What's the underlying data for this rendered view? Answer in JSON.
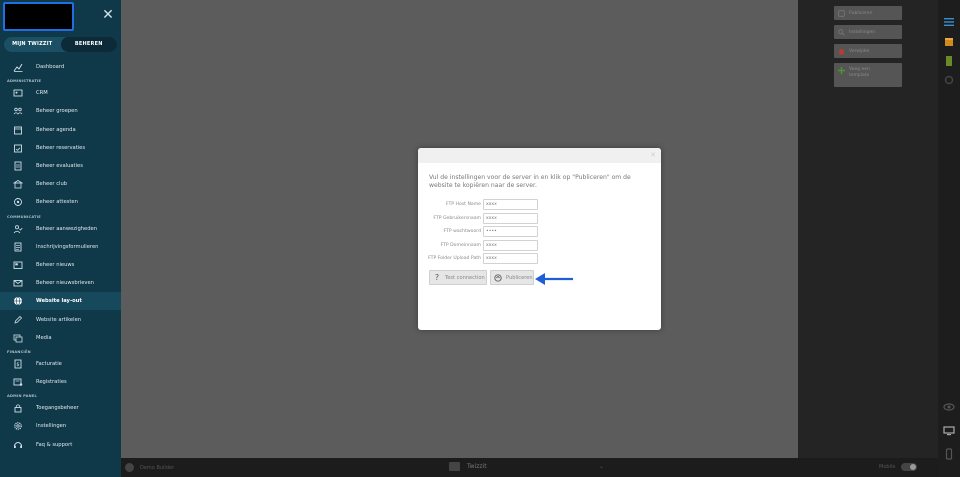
{
  "sidebar": {
    "tabs": [
      {
        "label": "MIJN TWIZZIT"
      },
      {
        "label": "BEHEREN"
      }
    ],
    "groups": [
      {
        "section": "",
        "items": [
          {
            "label": "Dashboard",
            "icon": "chart-line-icon"
          }
        ]
      },
      {
        "section": "ADMINISTRATIE",
        "items": [
          {
            "label": "CRM",
            "icon": "contact-card-icon"
          },
          {
            "label": "Beheer groepen",
            "icon": "group-icon"
          },
          {
            "label": "Beheer agenda",
            "icon": "calendar-icon"
          },
          {
            "label": "Beheer reservaties",
            "icon": "calendar-check-icon"
          },
          {
            "label": "Beheer evaluaties",
            "icon": "evaluation-icon"
          },
          {
            "label": "Beheer club",
            "icon": "building-icon"
          },
          {
            "label": "Beheer attesten",
            "icon": "certificate-icon"
          }
        ]
      },
      {
        "section": "COMMUNICATIE",
        "items": [
          {
            "label": "Beheer aanwezigheden",
            "icon": "user-check-icon"
          },
          {
            "label": "Inschrijvingsformulieren",
            "icon": "form-icon"
          },
          {
            "label": "Beheer nieuws",
            "icon": "newspaper-icon"
          },
          {
            "label": "Beheer nieuwsbrieven",
            "icon": "mail-icon"
          },
          {
            "label": "Website lay-out",
            "icon": "globe-icon",
            "active": true
          },
          {
            "label": "Website artikelen",
            "icon": "pencil-icon"
          },
          {
            "label": "Media",
            "icon": "media-icon"
          }
        ]
      },
      {
        "section": "FINANCIËN",
        "items": [
          {
            "label": "Facturatie",
            "icon": "invoice-icon"
          },
          {
            "label": "Registraties",
            "icon": "registration-icon"
          }
        ]
      },
      {
        "section": "ADMIN PANEL",
        "items": [
          {
            "label": "Toegangsbeheer",
            "icon": "lock-icon"
          },
          {
            "label": "Instellingen",
            "icon": "gear-icon"
          },
          {
            "label": "Faq & support",
            "icon": "headset-icon"
          }
        ]
      }
    ]
  },
  "right_panel": {
    "buttons": [
      {
        "label": "Publiceren",
        "icon": "publish-icon",
        "color": "#8a8a8a"
      },
      {
        "label": "Instellingen",
        "icon": "search-gear-icon",
        "color": "#8a8a8a"
      },
      {
        "label": "Verwijder",
        "icon": "trash-icon",
        "color": "#c0392b"
      },
      {
        "label": "Voeg een template",
        "icon": "plus-icon",
        "color": "#4a9a2a"
      }
    ]
  },
  "bottom_bar": {
    "left_label": "Demo Builder",
    "center_label": "Twizzit",
    "right_label": "Mobile"
  },
  "modal": {
    "intro": "Vul de instellingen voor de server in en klik op \"Publiceren\" om de website te kopiëren naar de server.",
    "fields": [
      {
        "label": "FTP Host Name",
        "value": "xxxx"
      },
      {
        "label": "FTP Gebruikersnaam",
        "value": "xxxx"
      },
      {
        "label": "FTP wachtwoord",
        "value": "••••"
      },
      {
        "label": "FTP Domeinnaam",
        "value": "xxxx"
      },
      {
        "label": "FTP Folder Upload Path",
        "value": "xxxx"
      }
    ],
    "test_button": "Test connection",
    "publish_button": "Publiceren"
  },
  "colors": {
    "sidebar_bg": "#0f3848",
    "highlight_border": "#1f6fe0",
    "arrow": "#1f5fd6"
  }
}
